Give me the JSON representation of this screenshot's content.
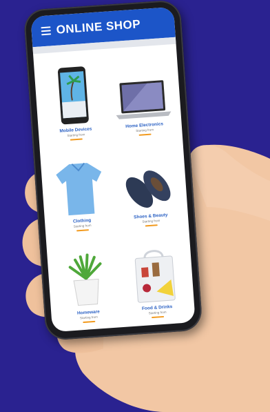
{
  "app": {
    "title": "ONLINE SHOP",
    "header_color": "#1c55c8",
    "background_color": "#2a2290",
    "accent_color": "#f29a1e"
  },
  "products": [
    {
      "name": "Mobile Devices",
      "price": "Starting from",
      "offer": "",
      "button": "",
      "icon": "smartphone-icon"
    },
    {
      "name": "Home Electronics",
      "price": "Starting from",
      "offer": "",
      "button": "",
      "icon": "laptop-icon"
    },
    {
      "name": "Clothing",
      "price": "Starting from",
      "offer": "",
      "button": "",
      "icon": "shirt-icon"
    },
    {
      "name": "Shoes & Beauty",
      "price": "Starting from",
      "offer": "",
      "button": "",
      "icon": "shoes-icon"
    },
    {
      "name": "Homeware",
      "price": "Starting from",
      "offer": "",
      "button": "",
      "icon": "plant-icon"
    },
    {
      "name": "Food & Drinks",
      "price": "Starting from",
      "offer": "",
      "button": "",
      "icon": "grocery-bag-icon"
    }
  ]
}
